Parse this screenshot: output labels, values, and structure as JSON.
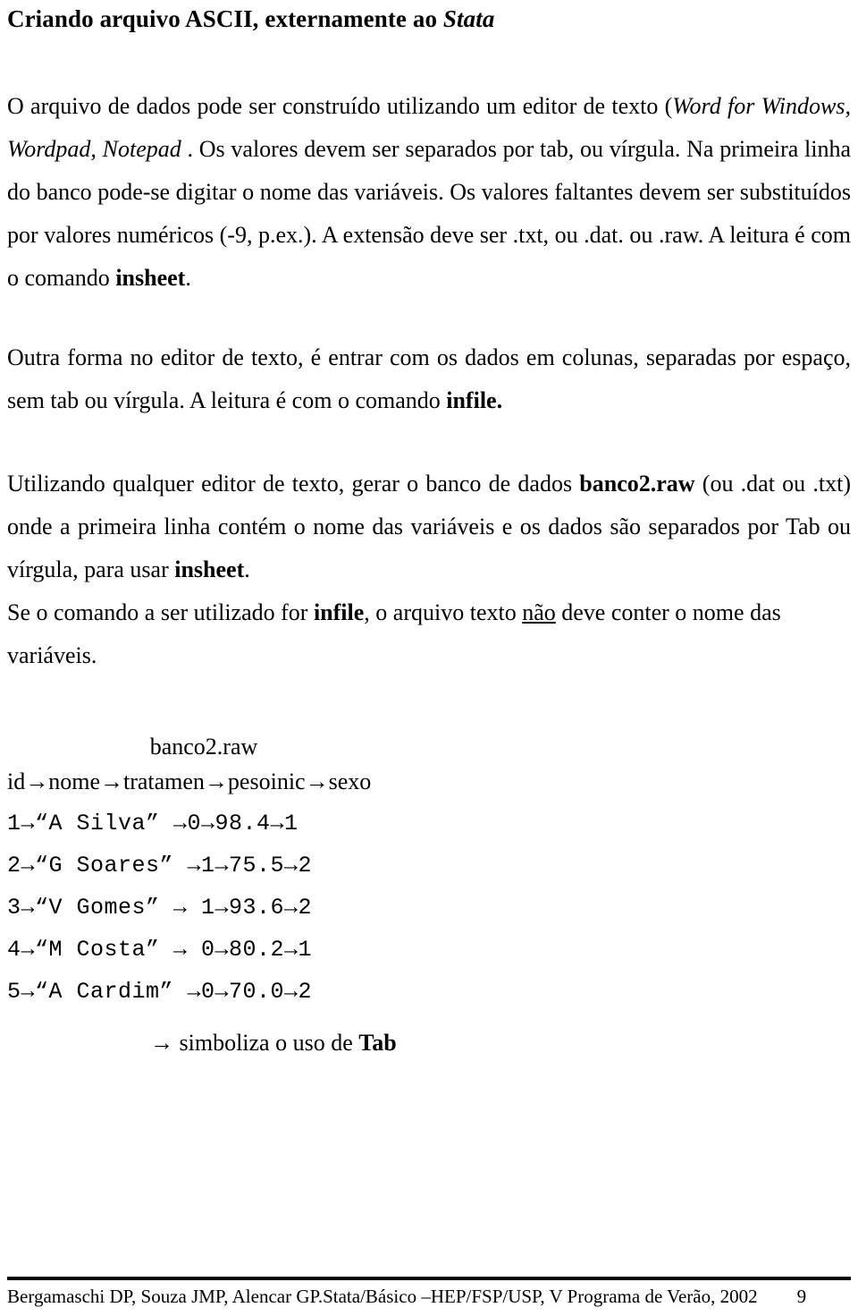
{
  "document": {
    "title_parts": {
      "plain": "Criando arquivo ASCII, externamente ao ",
      "italic": "Stata"
    },
    "paragraphs": {
      "p1": {
        "seg1": "O arquivo de dados pode ser construído utilizando um editor de texto (",
        "seg2_italic": "Word for Windows, Wordpad, Notepad",
        "seg3": " . Os valores devem ser separados por tab, ou vírgula. Na primeira linha do banco pode-se digitar o nome das variáveis. Os valores faltantes devem ser substituídos por valores numéricos (-9, p.ex.). A extensão deve ser .txt, ou .dat. ou .raw. A leitura é com o comando ",
        "seg4_bold": "insheet",
        "seg5": "."
      },
      "p2": {
        "seg1": "Outra forma no editor de texto, é entrar com os dados em colunas, separadas por espaço, sem tab ou vírgula. A leitura é com o comando ",
        "seg2_bold": "infile."
      },
      "p3": {
        "seg1": "Utilizando qualquer editor de texto, gerar o banco de dados ",
        "seg2_bold": "banco2.raw",
        "seg3": " (ou .dat ou .txt) onde a primeira linha contém o nome das variáveis e os dados são separados por Tab ou vírgula, para usar ",
        "seg4_bold": "insheet",
        "seg5": "."
      },
      "p4": {
        "seg1": "Se o comando a ser utilizado for ",
        "seg2_bold": "infile",
        "seg3": ", o arquivo texto ",
        "seg4_underline": "não",
        "seg5": " deve conter o nome das variáveis."
      }
    },
    "data_block": {
      "file_title": "banco2.raw",
      "header_row": "id→nome→tratamen→pesoinic→sexo",
      "rows": [
        "1→“A Silva” →0→98.4→1",
        "2→“G Soares” →1→75.5→2",
        "3→“V Gomes” → 1→93.6→2",
        "4→“M Costa” → 0→80.2→1",
        "5→“A Cardim” →0→70.0→2"
      ],
      "legend": {
        "arrow": "→ ",
        "text": "simboliza o uso de ",
        "bold": "Tab"
      }
    },
    "footer": {
      "citation": "Bergamaschi DP, Souza JMP, Alencar GP.Stata/Básico –HEP/FSP/USP, V Programa de Verão, 2002",
      "page_number": "9"
    }
  }
}
